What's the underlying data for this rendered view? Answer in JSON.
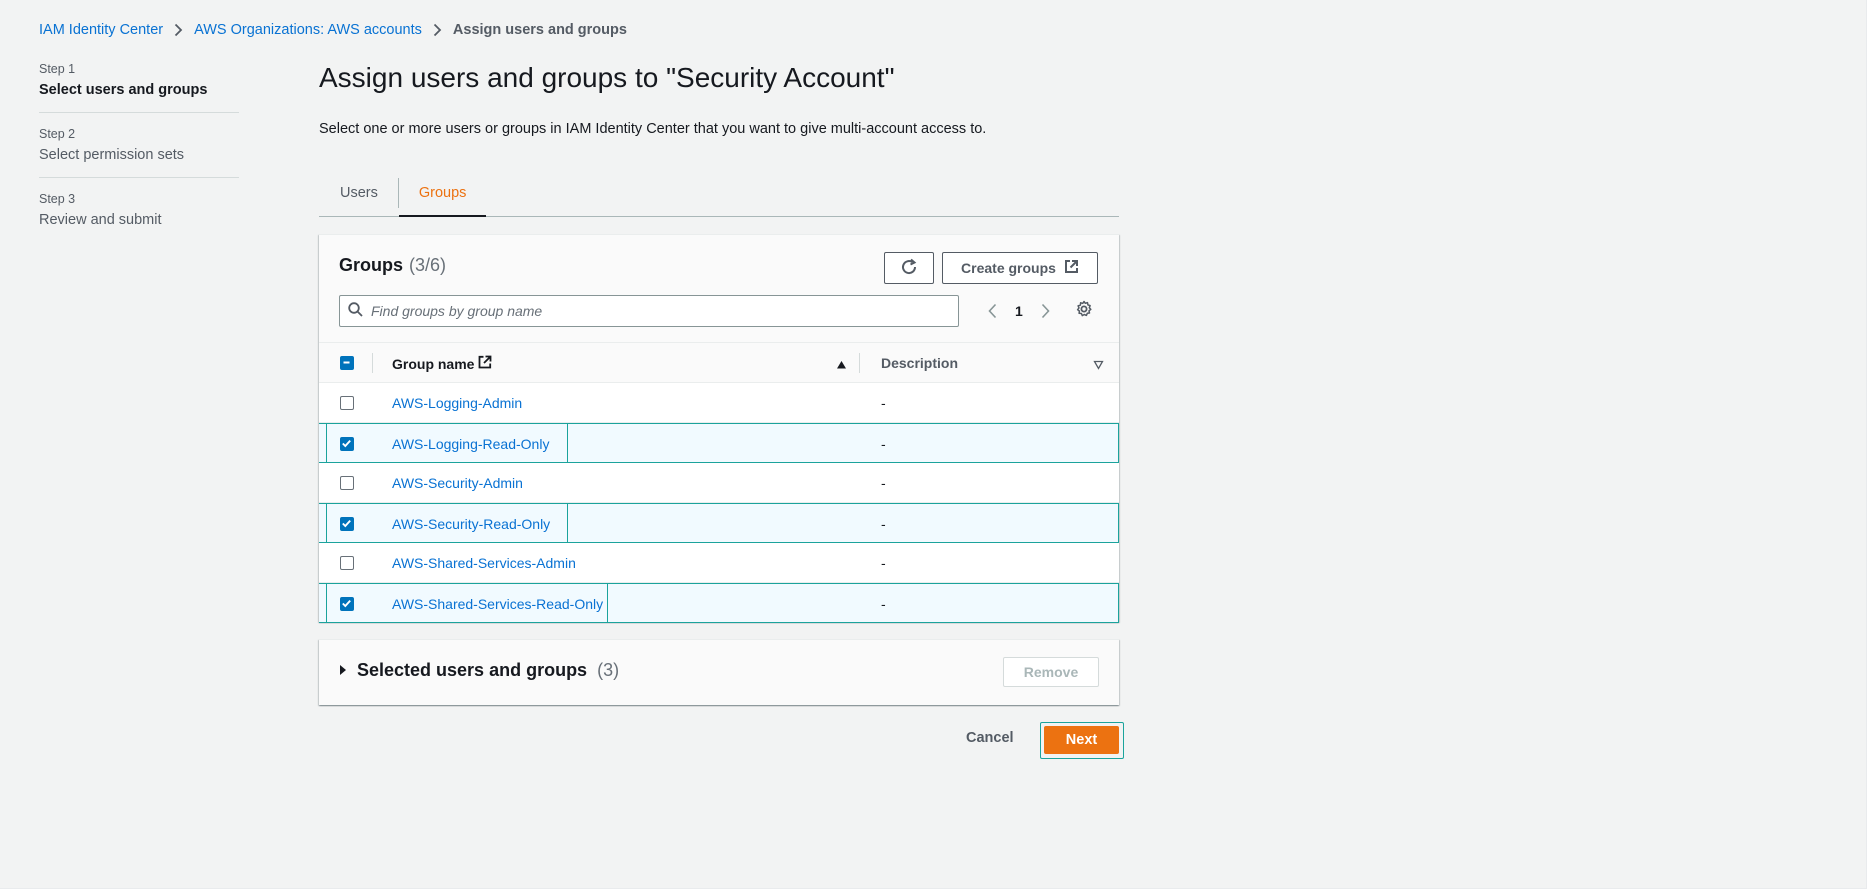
{
  "breadcrumb": {
    "items": [
      "IAM Identity Center",
      "AWS Organizations: AWS accounts"
    ],
    "current": "Assign users and groups"
  },
  "steps": [
    {
      "num": "Step 1",
      "title": "Select users and groups",
      "active": true
    },
    {
      "num": "Step 2",
      "title": "Select permission sets",
      "active": false
    },
    {
      "num": "Step 3",
      "title": "Review and submit",
      "active": false
    }
  ],
  "page": {
    "title": "Assign users and groups to \"Security Account\"",
    "description": "Select one or more users or groups in IAM Identity Center that you want to give multi-account access to."
  },
  "tabs": [
    {
      "label": "Users",
      "active": false
    },
    {
      "label": "Groups",
      "active": true
    }
  ],
  "table": {
    "title": "Groups",
    "count": "(3/6)",
    "create_label": "Create groups",
    "search_placeholder": "Find groups by group name",
    "page_number": "1",
    "columns": {
      "name": "Group name",
      "description": "Description"
    },
    "rows": [
      {
        "name": "AWS-Logging-Admin",
        "description": "-",
        "checked": false
      },
      {
        "name": "AWS-Logging-Read-Only",
        "description": "-",
        "checked": true
      },
      {
        "name": "AWS-Security-Admin",
        "description": "-",
        "checked": false
      },
      {
        "name": "AWS-Security-Read-Only",
        "description": "-",
        "checked": true
      },
      {
        "name": "AWS-Shared-Services-Admin",
        "description": "-",
        "checked": false
      },
      {
        "name": "AWS-Shared-Services-Read-Only",
        "description": "-",
        "checked": true
      }
    ]
  },
  "selected_section": {
    "title": "Selected users and groups",
    "count": "(3)",
    "remove_label": "Remove"
  },
  "footer": {
    "cancel_label": "Cancel",
    "next_label": "Next"
  },
  "colors": {
    "link": "#0972d3",
    "accent": "#ec7211",
    "checkbox": "#0073bb",
    "highlight": "#1ba39c"
  }
}
